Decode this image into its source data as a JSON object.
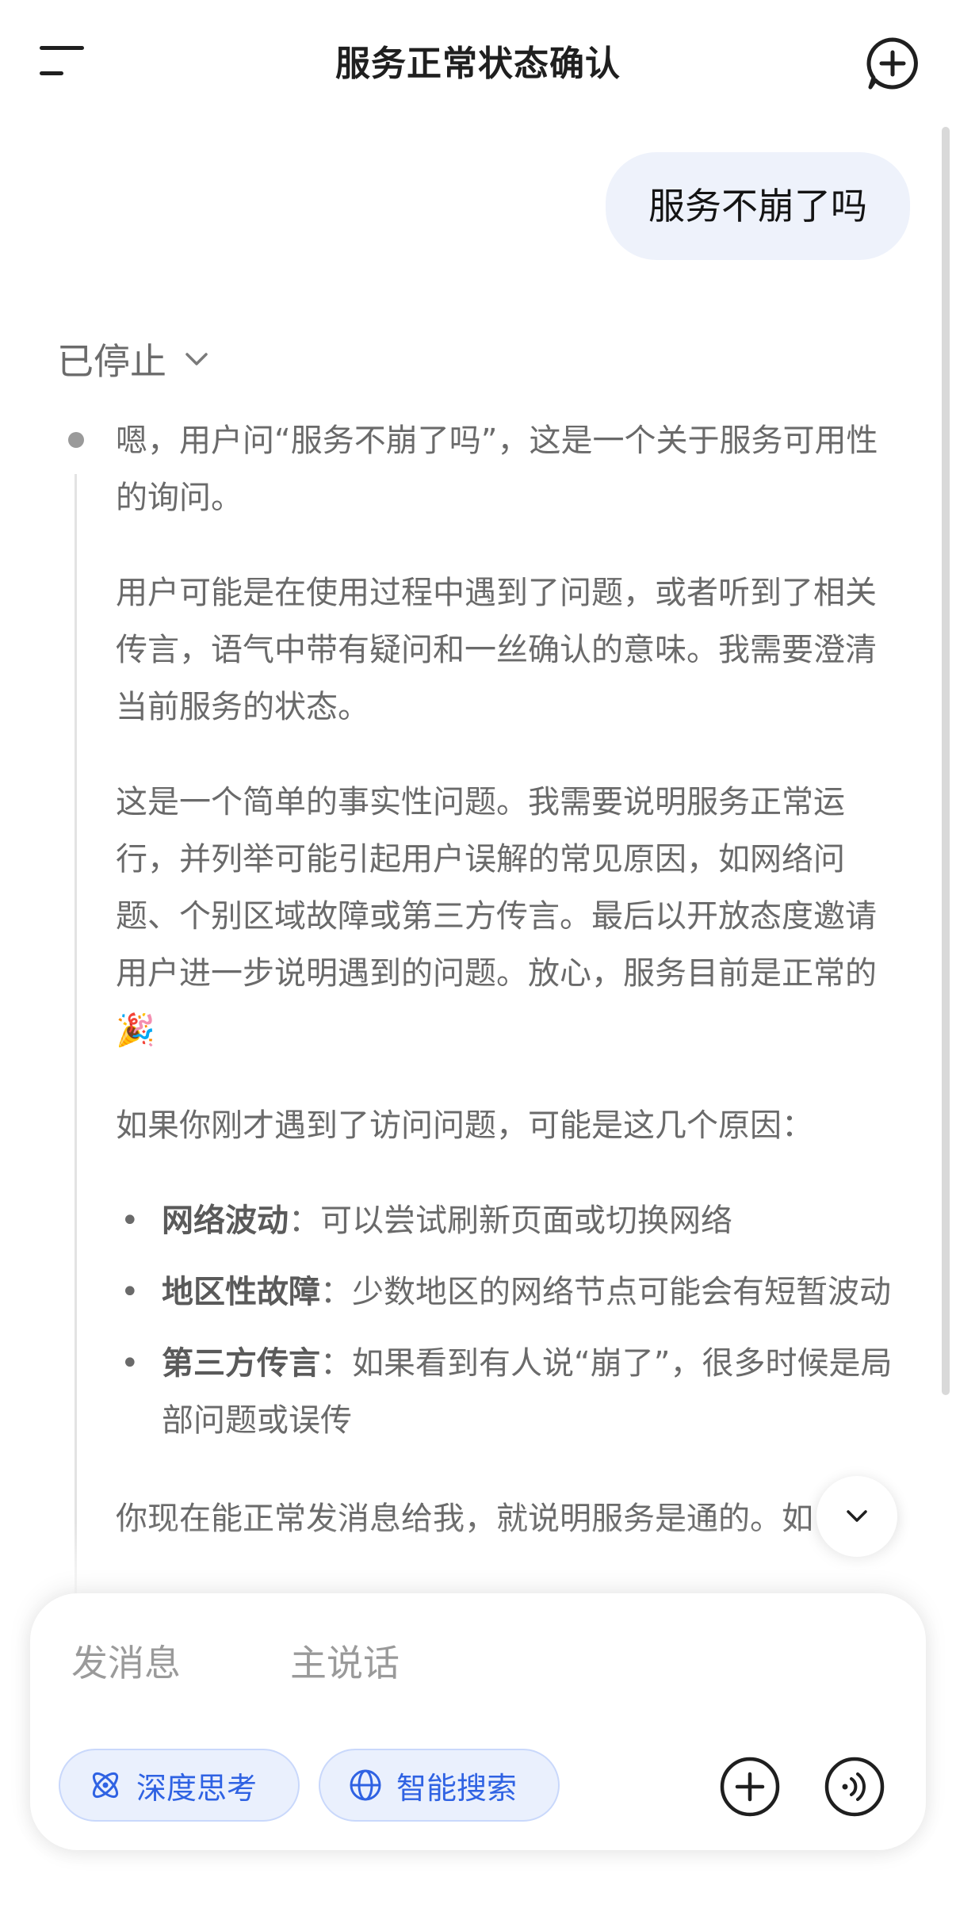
{
  "header": {
    "title": "服务正常状态确认"
  },
  "conversation": {
    "user_message": "服务不崩了吗",
    "thinking_status": "已停止",
    "thought_paragraphs": [
      "嗯，用户问“服务不崩了吗”，这是一个关于服务可用性的询问。",
      "用户可能是在使用过程中遇到了问题，或者听到了相关传言，语气中带有疑问和一丝确认的意味。我需要澄清当前服务的状态。",
      "这是一个简单的事实性问题。我需要说明服务正常运行，并列举可能引起用户误解的常见原因，如网络问题、个别区域故障或第三方传言。最后以开放态度邀请用户进一步说明遇到的问题。放心，服务目前是正常的🎉",
      "如果你刚才遇到了访问问题，可能是这几个原因："
    ],
    "reasons": [
      {
        "title": "网络波动",
        "text": "：可以尝试刷新页面或切换网络"
      },
      {
        "title": "地区性故障",
        "text": "：少数地区的网络节点可能会有短暂波动"
      },
      {
        "title": "第三方传言",
        "text": "：如果看到有人说“崩了”，很多时候是局部问题或误传"
      }
    ],
    "closing_partial": "你现在能正常发消息给我，就说明服务是通的。如"
  },
  "composer": {
    "placeholder": "发消息　　　主说话",
    "deep_think_label": "深度思考",
    "smart_search_label": "智能搜索"
  },
  "icons": {
    "menu": "menu-icon",
    "new_chat": "new-chat-icon",
    "chevron": "chevron-down-icon",
    "atom": "atom-icon",
    "globe": "globe-icon",
    "add": "plus-icon",
    "voice": "voice-icon"
  },
  "colors": {
    "accent": "#2f62e3",
    "chip_bg": "#eaf0fd",
    "user_bubble": "#eef2fb"
  }
}
